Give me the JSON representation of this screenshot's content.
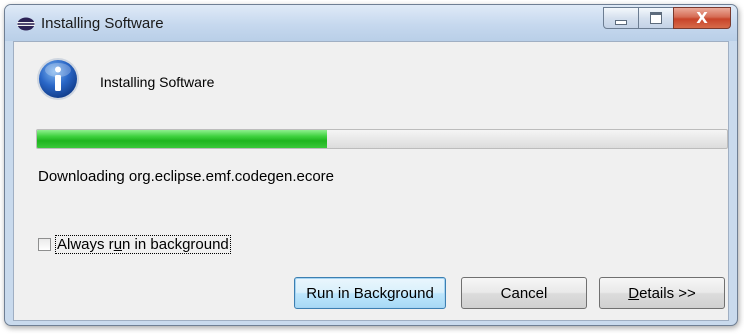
{
  "window": {
    "title": "Installing Software",
    "close_glyph": "X",
    "title_icon": "eclipse-icon"
  },
  "dialog": {
    "heading": "Installing Software",
    "icon": "info-icon",
    "progress": 0.42,
    "status_text": "Downloading org.eclipse.emf.codegen.ecore",
    "checkbox": {
      "label_pre": "Always r",
      "label_mnemonic": "u",
      "label_post": "n in background",
      "checked": false
    },
    "buttons": {
      "run_in_background": "Run in Background",
      "cancel": "Cancel",
      "details_mnemonic": "D",
      "details_rest": "etails >>"
    }
  },
  "colors": {
    "progress_fill": "#2fc22f",
    "default_button_border": "#3c7fb1",
    "close_button": "#c8442a"
  }
}
